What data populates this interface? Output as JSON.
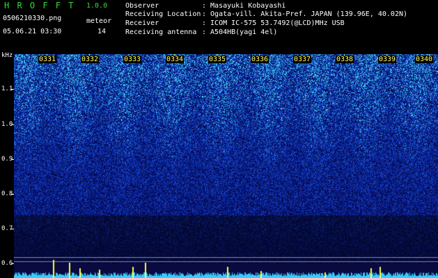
{
  "header": {
    "app_title": "H R O F F T",
    "version": "1.0.0",
    "filename": "0506210330.png",
    "meteor_label": "meteor",
    "datetime": "05.06.21 03:30",
    "meteor_count": "14"
  },
  "station": [
    {
      "label": "Observer",
      "value": ": Masayuki Kobayashi"
    },
    {
      "label": "Receiving Location",
      "value": ": Ogata-vill. Akita-Pref. JAPAN (139.96E, 40.02N)"
    },
    {
      "label": "Receiver",
      "value": ": ICOM IC-575 53.7492(@LCD)MHz USB"
    },
    {
      "label": "Receiving antenna",
      "value": ": A504HB(yagi 4el)"
    }
  ],
  "y_axis": {
    "unit": "kHz",
    "ticks": [
      {
        "label": "1.1",
        "value": 1.1
      },
      {
        "label": "1.0",
        "value": 1.0
      },
      {
        "label": "0.9",
        "value": 0.9
      },
      {
        "label": "0.8",
        "value": 0.8
      },
      {
        "label": "0.7",
        "value": 0.7
      },
      {
        "label": "0.6",
        "value": 0.6
      }
    ]
  },
  "time_axis": {
    "labels": [
      "0331",
      "0332",
      "0333",
      "0334",
      "0335",
      "0336",
      "0337",
      "0338",
      "0339",
      "0340"
    ]
  },
  "colors": {
    "spectrum_base": "#0a1a8c",
    "noise_high": "#3fd0ff",
    "meteor": "#ffff44",
    "baseline": "#33ccff"
  }
}
